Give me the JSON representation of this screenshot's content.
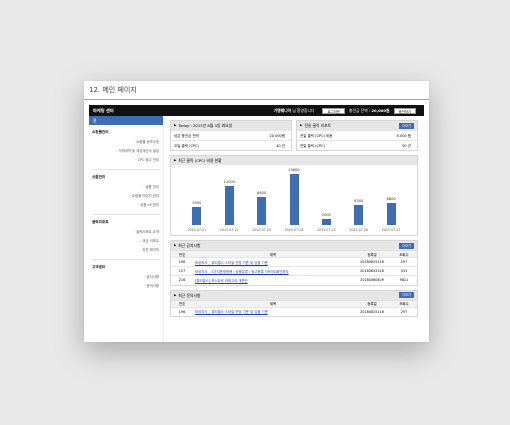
{
  "page_title": "12. 메인 페이지",
  "topbar": {
    "logo": "마케팅 센터",
    "user_name": "가맹웨니아",
    "user_suffix": "님 환영합니다",
    "logout_label": "로그아웃",
    "balance_label": "충전금 잔액 :",
    "balance_value": "20,000원",
    "charge_label": "충전하기"
  },
  "sidebar": {
    "head": "홈",
    "sections": [
      {
        "title": "쇼핑몰관리",
        "items": [
          "쇼핑몰 정보수정",
          "거래내역 및 세금계산서 발급",
          "CPC 광고 관리"
        ]
      },
      {
        "title": "상품관리",
        "items": [
          "상품 관리",
          "쇼핑몰 이미지 관리",
          "상품 eP 관리"
        ]
      },
      {
        "title": "클릭리포트",
        "items": [
          "클릭리포트 요약",
          "과금 리포트",
          "추천 매각작"
        ]
      },
      {
        "title": "고객센터",
        "items": [
          "공지사항",
          "문의사항"
        ]
      }
    ]
  },
  "today": {
    "head": "Today : 2015년 8월 4일 화요일",
    "rows": [
      {
        "k": "남은 충전금 전액",
        "v": "20,000원"
      },
      {
        "k": "오늘 클릭 (CPC)",
        "v": "40 건"
      }
    ]
  },
  "click_report": {
    "head": "전일 클릭 리포트",
    "more": "더보기",
    "rows": [
      {
        "k": "전일 클릭 (CPC) 비용",
        "v": "5,000 원"
      },
      {
        "k": "전일 클릭 (CPC)",
        "v": "50 건"
      }
    ]
  },
  "chart_box": {
    "head": "최근 클릭 (CPC) 비용 현황"
  },
  "chart_data": {
    "type": "bar",
    "categories": [
      "2015-07-21",
      "2015-07-22",
      "2015-07-23",
      "2015-07-24",
      "2015-07-25",
      "2015-07-26",
      "2015-07-27"
    ],
    "values": [
      5500,
      12000,
      8600,
      15600,
      2000,
      6200,
      6800
    ],
    "ylim": [
      0,
      16000
    ],
    "color": "#3d6db3"
  },
  "notices": {
    "head": "최근 공지사항",
    "more": "더보기",
    "columns": [
      "번호",
      "제목",
      "등록일",
      "조회수"
    ],
    "rows": [
      {
        "no": "196",
        "title": "보공지사 _ 뷰티멀스 스타일 연장 기준 및 입점 기준",
        "date": "20180825116",
        "views": "297"
      },
      {
        "no": "157",
        "title": "보공지사 _ 5가지운영정책 / 상품분류 / 광고등록 TIP이도확인하자",
        "date": "20180652316",
        "views": "531"
      },
      {
        "no": "216",
        "title": "[뷰티멀스] 포스트릭 카테고리 개편안",
        "date": "20180060409",
        "views": "9821"
      }
    ]
  },
  "inquiries": {
    "head": "최근 문의사항",
    "more": "더보기",
    "columns": [
      "번호",
      "제목",
      "등록일",
      "조회수"
    ],
    "rows": [
      {
        "no": "196",
        "title": "보공지사 _ 뷰티멀스 스타일 연장 기준 및 입점 기준",
        "date": "20180825116",
        "views": "297"
      }
    ]
  }
}
